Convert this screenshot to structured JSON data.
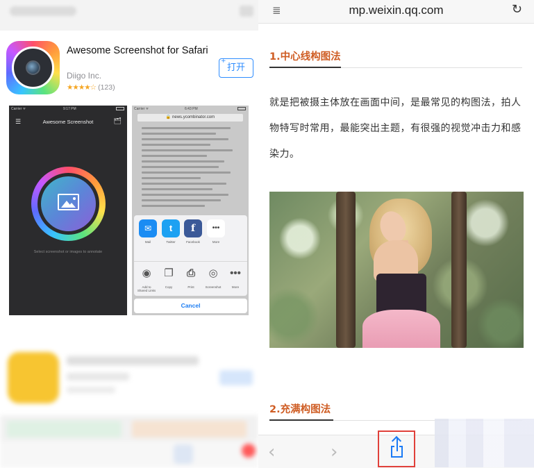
{
  "left": {
    "app": {
      "title": "Awesome Screenshot for Safari",
      "developer": "Diigo Inc.",
      "stars": "★★★★☆",
      "rating_count": "(123)",
      "open_label": "打开",
      "open_plus": "+"
    },
    "screenshot1": {
      "carrier": "Carrier ᯤ",
      "time": "9:17 PM",
      "menu_icon": "☰",
      "title": "Awesome Screenshot",
      "inbox_icon": "🗂",
      "hint": "Select screenshot or images to annotate"
    },
    "screenshot2": {
      "carrier": "Carrier ᯤ",
      "time": "6:43 PM",
      "url": "🔒 news.ycombinator.com",
      "share_row": [
        {
          "icon": "✉",
          "label": "Mail"
        },
        {
          "icon": "t",
          "label": "Twitter"
        },
        {
          "icon": "f",
          "label": "Facebook"
        },
        {
          "icon": "•••",
          "label": "More"
        }
      ],
      "action_row": [
        {
          "icon": "◉",
          "label": "Add to Shared Links"
        },
        {
          "icon": "❐",
          "label": "Copy"
        },
        {
          "icon": "⎙",
          "label": "Print"
        },
        {
          "icon": "◎",
          "label": "Screenshot"
        },
        {
          "icon": "•••",
          "label": "More"
        }
      ],
      "cancel_label": "Cancel"
    }
  },
  "right": {
    "reader_icon": "≣",
    "url": "mp.weixin.qq.com",
    "reload_icon": "↻",
    "section1_title": "1.中心线构图法",
    "body": "就是把被摄主体放在画面中间，是最常见的构图法，拍人物特写时常用，最能突出主题，有很强的视觉冲击力和感染力。",
    "section2_title": "2.充满构图法",
    "back_icon": "‹",
    "forward_icon": "›"
  },
  "colors": {
    "accent_blue": "#2d8cff",
    "section_orange": "#cf5d24",
    "highlight_red": "#e0403a",
    "star_gold": "#f5a623"
  }
}
